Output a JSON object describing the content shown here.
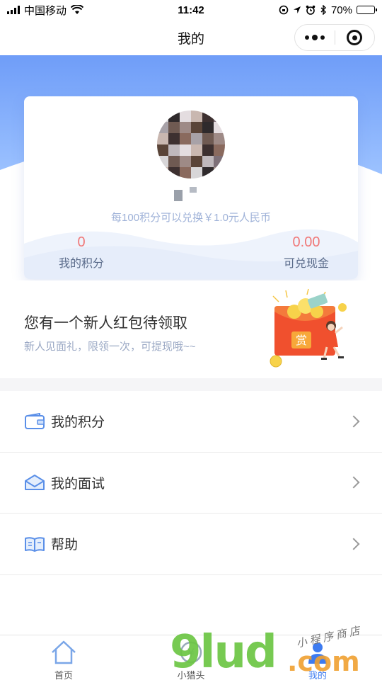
{
  "status_bar": {
    "carrier": "中国移动",
    "time": "11:42",
    "battery": "70%",
    "battery_level": 0.7
  },
  "nav": {
    "title": "我的"
  },
  "profile": {
    "exchange_hint": "每100积分可以兑换￥1.0元人民币",
    "points_value": "0",
    "points_label": "我的积分",
    "cash_value": "0.00",
    "cash_label": "可兑现金"
  },
  "promo": {
    "title": "您有一个新人红包待领取",
    "subtitle": "新人见面礼，限领一次，可提现哦~~",
    "packet_char": "赏"
  },
  "menu": {
    "items": [
      {
        "label": "我的积分",
        "icon": "wallet-icon"
      },
      {
        "label": "我的面试",
        "icon": "envelope-icon"
      },
      {
        "label": "帮助",
        "icon": "book-icon"
      }
    ]
  },
  "tabs": [
    {
      "label": "首页",
      "icon": "home-icon"
    },
    {
      "label": "小猎头",
      "icon": "headhunter-icon"
    },
    {
      "label": "我的",
      "icon": "profile-icon"
    }
  ],
  "watermark": {
    "main": "9lud",
    "suffix": ".com",
    "small": "小程序商店"
  },
  "colors": {
    "accent_blue": "#3d7bf0",
    "stat_red": "#f07878",
    "hero_gradient_start": "#8ab6ff",
    "hero_gradient_end": "#5f8ef2"
  }
}
